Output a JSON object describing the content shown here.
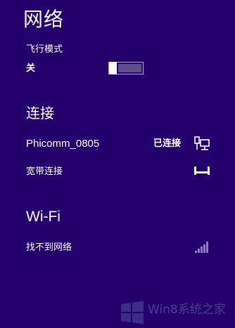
{
  "header": {
    "title": "网络"
  },
  "airplane_mode": {
    "label": "飞行模式",
    "state": "关",
    "on": false
  },
  "connections": {
    "title": "连接",
    "items": [
      {
        "label": "Phicomm_0805",
        "status": "已连接",
        "icon": "ethernet-icon"
      },
      {
        "label": "宽带连接",
        "status": "",
        "icon": "broadband-icon"
      }
    ]
  },
  "wifi": {
    "title": "Wi-Fi",
    "items": [
      {
        "label": "找不到网络",
        "icon": "wifi-signal-icon"
      }
    ]
  },
  "watermark": {
    "text": "Win8系统之家"
  },
  "colors": {
    "background": "#23006b",
    "text": "#ffffff",
    "toggle_track": "#5e4f8c",
    "watermark": "#4a3f8f"
  }
}
